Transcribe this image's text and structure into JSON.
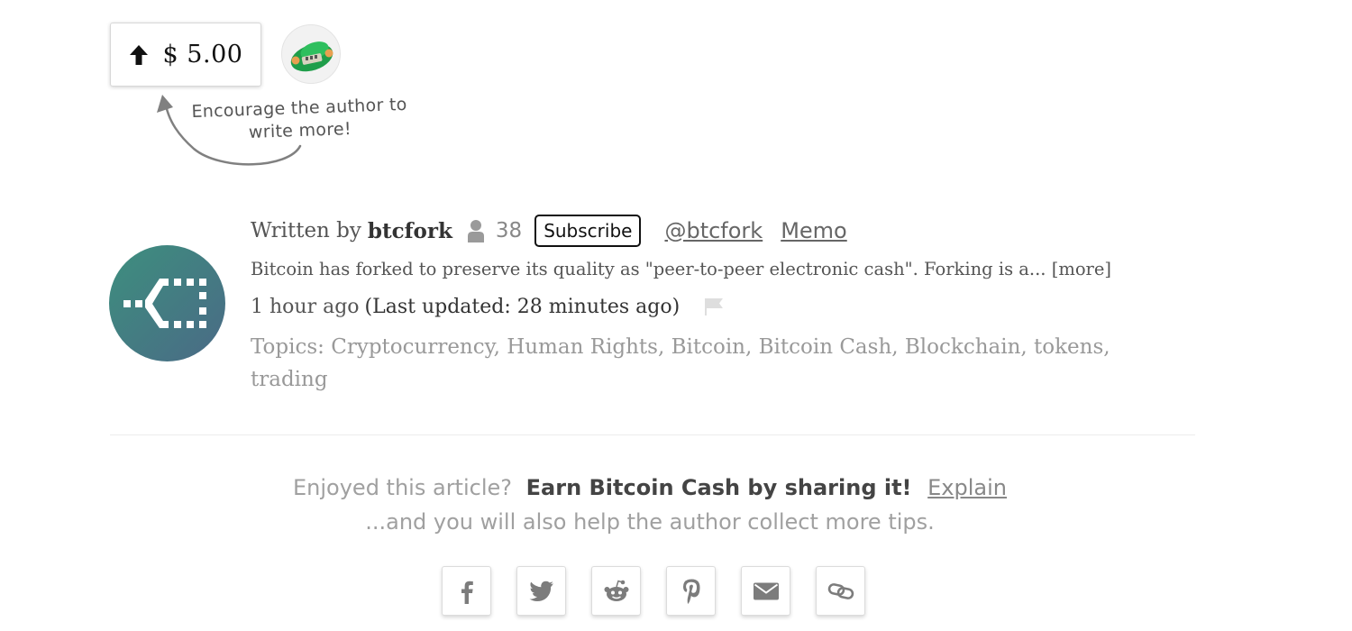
{
  "tip": {
    "amount": "$ 5.00",
    "encourage_text": "Encourage the author to write more!",
    "button_icon": "arrow-up-icon",
    "tipper_icon": "tipper-avatar"
  },
  "author": {
    "written_prefix": "Written by",
    "name": "btcfork",
    "subscriber_count": "38",
    "subscribe_label": "Subscribe",
    "twitter_handle": "@btcfork",
    "memo_label": "Memo",
    "bio": "Bitcoin has forked to preserve its quality as \"peer-to-peer electronic cash\". Forking is a...",
    "more_label": "[more]",
    "time_ago": "1 hour ago",
    "last_updated": "(Last updated: 28 minutes ago)",
    "topics_prefix": "Topics:",
    "topics": [
      "Cryptocurrency",
      "Human Rights",
      "Bitcoin",
      "Bitcoin Cash",
      "Blockchain",
      "tokens",
      "trading"
    ]
  },
  "share": {
    "question": "Enjoyed this article?",
    "cta": "Earn Bitcoin Cash by sharing it!",
    "explain_label": "Explain",
    "subline": "...and you will also help the author collect more tips.",
    "buttons": [
      "facebook-icon",
      "twitter-icon",
      "reddit-icon",
      "pinterest-icon",
      "email-icon",
      "link-icon"
    ]
  },
  "colors": {
    "muted_text": "#a0a0a0",
    "body_text": "#555555",
    "avatar_teal": "#3f7a80",
    "tipper_green": "#1f9e4a"
  }
}
